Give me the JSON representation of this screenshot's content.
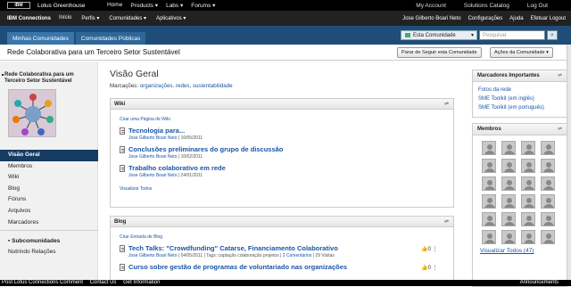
{
  "header": {
    "logo": "IBM",
    "site": "Lotus Greenhouse",
    "nav": [
      "Home",
      "Products ▾",
      "Labs ▾",
      "Forums ▾"
    ],
    "right_links": [
      "My Account",
      "Solutions Catalog",
      "Log Out"
    ]
  },
  "connbar": {
    "brand": "IBM Connections",
    "nav": [
      "Início",
      "Perfis ▾",
      "Comunidades ▾",
      "Aplicativos ▾"
    ],
    "user": "Jose Gilberto Boari Neto",
    "right_links": [
      "Configurações",
      "Ajuda",
      "Efetuar Logout"
    ]
  },
  "tabs": [
    "Minhas Comunidades",
    "Comunidades Públicas"
  ],
  "search": {
    "scope": "Esta Comunidade",
    "placeholder": "Pesquisar"
  },
  "community": {
    "title": "Rede Colaborativa para um Terceiro Setor Sustentável",
    "sidebar_title": "Rede Colaborativa para um Terceiro Setor Sustentável",
    "follow_button": "Parar de Seguir esta Comunidade",
    "actions_button": "Ações da Comunidade ▾"
  },
  "left_nav": {
    "items": [
      "Visão Geral",
      "Membros",
      "Wiki",
      "Blog",
      "Fóruns",
      "Arquivos",
      "Marcadores"
    ],
    "sub_header": "Subcomunidades",
    "sub_items": [
      "Nutrindo Relações"
    ]
  },
  "main": {
    "heading": "Visão Geral",
    "tags_label": "Marcações:",
    "tags": "organizações, redes, sustentabilidade"
  },
  "wiki": {
    "title": "Wiki",
    "create_link": "Criar uma Página de Wiki",
    "entries": [
      {
        "title": "Tecnologia para...",
        "author": "Jose Gilberto Boari Neto",
        "date": "10/05/2011"
      },
      {
        "title": "Conclusões preliminares do grupo de discussão",
        "author": "Jose Gilberto Boari Neto",
        "date": "10/02/2011"
      },
      {
        "title": "Trabalho colaborativo em rede",
        "author": "Jose Gilberto Boari Neto",
        "date": "24/01/2011"
      }
    ],
    "view_all": "Visualizar Todos"
  },
  "blog": {
    "title": "Blog",
    "create_link": "Criar Entrada de Blog",
    "entries": [
      {
        "title": "Tech Talks: \"Crowdfunding\" Catarse, Financiamento Colaborativo",
        "author": "Jose Gilberto Boari Neto",
        "date": "04/05/2011",
        "tags": "Tags: captação colaboração projetos",
        "comments": "2 Comentários",
        "visits": "29 Visitas",
        "likes": "0"
      },
      {
        "title": "Curso sobre gestão de programas de voluntariado nas organizações",
        "likes": "0"
      }
    ]
  },
  "bookmarks": {
    "title": "Marcadores Importantes",
    "items": [
      "Fotos da rede",
      "SME Toolkit (em inglês)",
      "SME Toolkit (em português)"
    ]
  },
  "members": {
    "title": "Membros",
    "view_all": "Visualizar Todos (47)"
  },
  "footer": {
    "links": [
      "Post Lotus Connections Comment",
      "Contact Us",
      "Get Information"
    ],
    "announcements": "Announcements"
  }
}
